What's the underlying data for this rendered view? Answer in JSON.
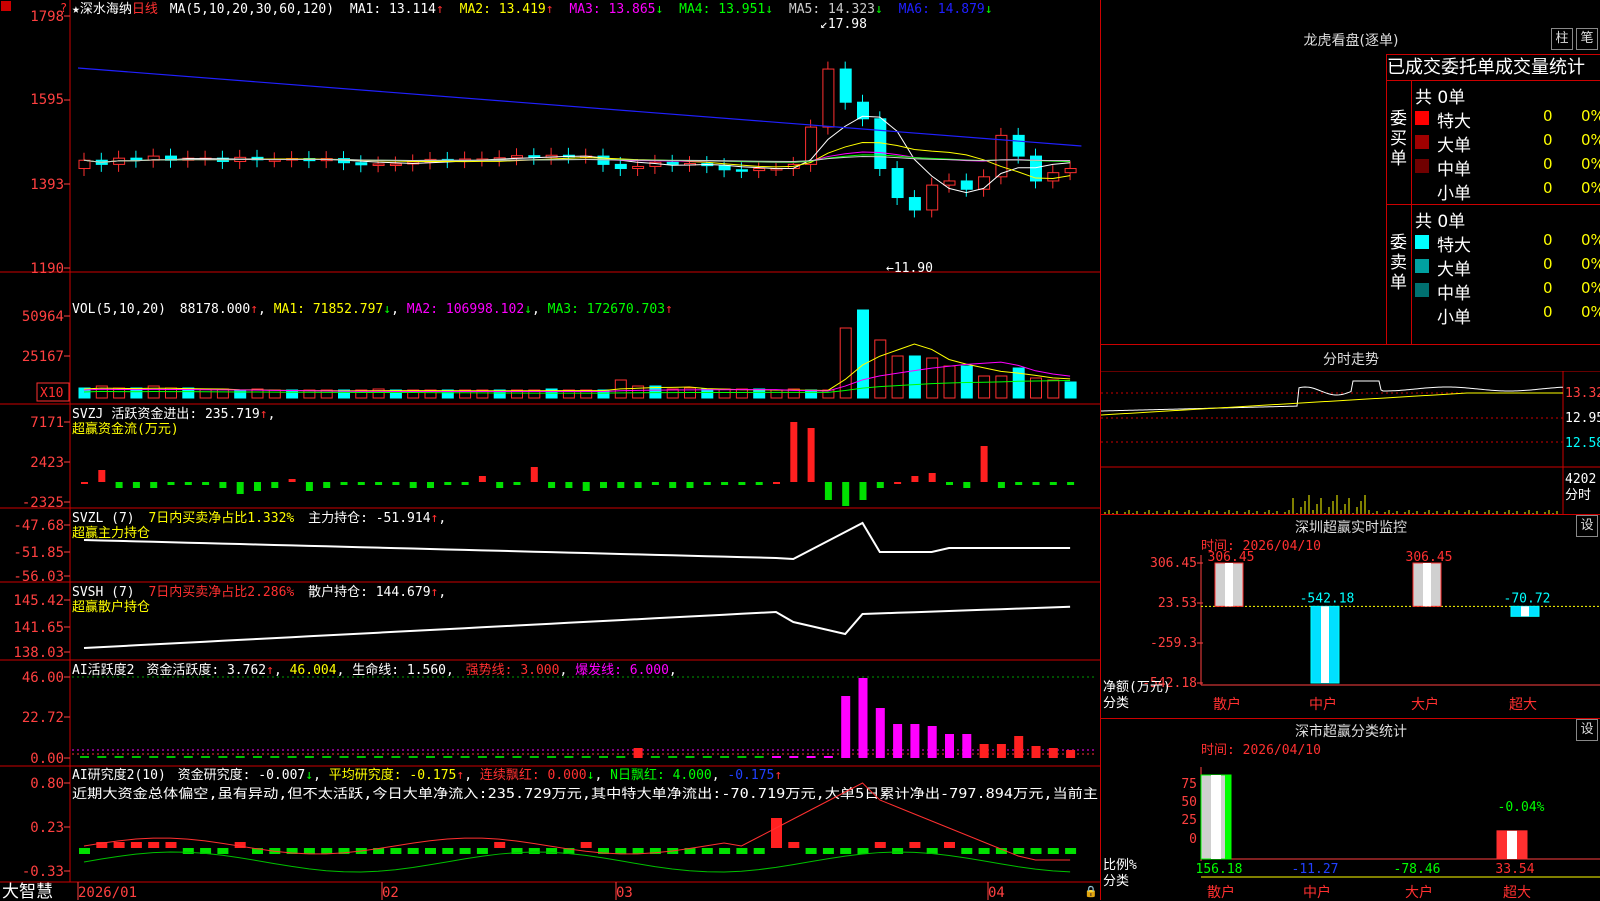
{
  "corner_mark": "?",
  "stock": {
    "star": "★",
    "name": "深水海纳",
    "period": "日线"
  },
  "main_ma": {
    "label": "MA(5,10,20,30,60,120)",
    "items": [
      {
        "text": "MA1: 13.114",
        "arrow": "↑",
        "color": "#ffffff"
      },
      {
        "text": "MA2: 13.419",
        "arrow": "↑",
        "color": "#ffff00"
      },
      {
        "text": "MA3: 13.865",
        "arrow": "↓",
        "color": "#ff00ff"
      },
      {
        "text": "MA4: 13.951",
        "arrow": "↓",
        "color": "#00ff00"
      },
      {
        "text": "MA5: 14.323",
        "arrow": "↓",
        "color": "#cccccc"
      },
      {
        "text": "MA6: 14.879",
        "arrow": "↓",
        "color": "#2020ff"
      }
    ],
    "high_label": "17.98",
    "low_label": "11.90"
  },
  "price_axis": [
    "1798",
    "1595",
    "1393",
    "1190"
  ],
  "vol_panel": {
    "label": "VOL(5,10,20)",
    "value": "88178.000",
    "items": [
      {
        "text": "MA1: 71852.797",
        "arrow": "↓",
        "color": "#ffff00"
      },
      {
        "text": "MA2: 106998.102",
        "arrow": "↓",
        "color": "#ff00ff"
      },
      {
        "text": "MA3: 172670.703",
        "arrow": "↑",
        "color": "#00ff00"
      }
    ],
    "axis": [
      "50964",
      "25167"
    ],
    "unit": "X10"
  },
  "svzj_panel": {
    "title": "SVZJ",
    "line1": "活跃资金进出: 235.719",
    "subtitle": "超赢资金流(万元)",
    "axis": [
      "7171",
      "2423",
      "-2325"
    ]
  },
  "svzl_panel": {
    "title": "SVZL (7)",
    "ratio": "7日内买卖净占比1.332%",
    "hold": "主力持仓: -51.914",
    "subtitle": "超赢主力持仓",
    "axis": [
      "-47.68",
      "-51.85",
      "-56.03"
    ]
  },
  "svsh_panel": {
    "title": "SVSH (7)",
    "ratio": "7日内买卖净占比2.286%",
    "hold": "散户持仓: 144.679",
    "subtitle": "超赢散户持仓",
    "axis": [
      "145.42",
      "141.65",
      "138.03"
    ]
  },
  "ai_active": {
    "title": "AI活跃度2",
    "items": [
      {
        "text": "资金活跃度: 3.762",
        "color": "#ffffff"
      },
      {
        "text": "46.004",
        "color": "#ffff00"
      },
      {
        "text": "生命线: 1.560",
        "color": "#ffffff"
      },
      {
        "text": "强势线: 3.000",
        "color": "#ff3030"
      },
      {
        "text": "爆发线: 6.000",
        "color": "#ff00ff"
      }
    ],
    "axis": [
      "46.00",
      "22.72",
      "0.00"
    ]
  },
  "ai_research": {
    "title": "AI研究度2(10)",
    "items": [
      {
        "text": "资金研究度: -0.007",
        "color": "#ffffff"
      },
      {
        "text": "平均研究度: -0.175",
        "color": "#ffff00"
      },
      {
        "text": "连续飘红: 0.000",
        "color": "#ff3030"
      },
      {
        "text": "N日飘红: 4.000",
        "color": "#00ff00"
      },
      {
        "text": "-0.175",
        "color": "#2040ff"
      }
    ],
    "commentary": "近期大资金总体偏空,虽有异动,但不太活跃,今日大单净流入:235.729万元,其中特大单净流出:-70.719万元,大单5日累计净出-797.894万元,当前主",
    "axis": [
      "0.80",
      "0.23",
      "-0.33"
    ]
  },
  "time_axis": [
    "2026/01",
    "02",
    "03",
    "04"
  ],
  "brand": "大智慧",
  "longhu": {
    "title": "龙虎看盘(逐单)",
    "btn1": "柱",
    "btn2": "笔",
    "header": "已成交委托单成交量统计",
    "buy": {
      "side": "委买单",
      "total": "共 0单",
      "rows": [
        {
          "label": "特大",
          "count": "0",
          "pct": "0%",
          "color": "#ff0000"
        },
        {
          "label": "大单",
          "count": "0",
          "pct": "0%",
          "color": "#a00000"
        },
        {
          "label": "中单",
          "count": "0",
          "pct": "0%",
          "color": "#700000"
        },
        {
          "label": "小单",
          "count": "0",
          "pct": "0%",
          "color": ""
        }
      ]
    },
    "sell": {
      "side": "委卖单",
      "total": "共 0单",
      "rows": [
        {
          "label": "特大",
          "count": "0",
          "pct": "0%",
          "color": "#00ffff"
        },
        {
          "label": "大单",
          "count": "0",
          "pct": "0%",
          "color": "#00a0a0"
        },
        {
          "label": "中单",
          "count": "0",
          "pct": "0%",
          "color": "#007070"
        },
        {
          "label": "小单",
          "count": "0",
          "pct": "0%",
          "color": ""
        }
      ]
    }
  },
  "intraday": {
    "title": "分时走势",
    "price_axis": [
      "13.32",
      "12.95",
      "12.58"
    ],
    "vol_label": "4202",
    "vol_unit": "分时"
  },
  "sz_monitor": {
    "title": "深圳超赢实时监控",
    "btn": "设",
    "time": "时间: 2026/04/10",
    "axis": [
      "306.45",
      "23.53",
      "-259.3",
      "-542.18"
    ],
    "ylabel": "净额(万元)",
    "xlabel": "分类",
    "categories": [
      "散户",
      "中户",
      "大户",
      "超大"
    ],
    "values": [
      306.45,
      -542.18,
      306.45,
      -70.72
    ],
    "value_labels": [
      "306.45",
      "-542.18",
      "306.45",
      "-70.72"
    ]
  },
  "sz_class": {
    "title": "深市超赢分类统计",
    "btn": "设",
    "time": "时间: 2026/04/10",
    "axis": [
      "75",
      "50",
      "25",
      "0"
    ],
    "ylabel": "比例%",
    "xlabel": "分类",
    "categories": [
      "散户",
      "中户",
      "大户",
      "超大"
    ],
    "bottom_values": [
      "156.18",
      "-11.27",
      "-78.46",
      "33.54"
    ],
    "bar_pct": [
      100,
      0,
      0,
      33.54
    ],
    "top_label": "-0.04%"
  },
  "colors": {
    "up": "#ff3030",
    "down": "#00ffff",
    "border": "#cc0000",
    "axis_text": "#ff4040"
  }
}
